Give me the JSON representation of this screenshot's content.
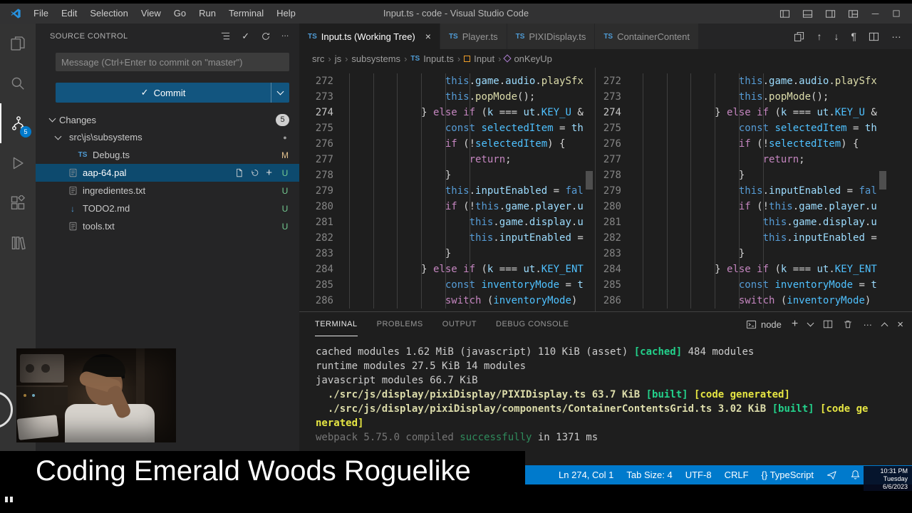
{
  "overlay": {
    "caption": "Coding Emerald Woods Roguelike",
    "clock": {
      "time": "10:31 PM",
      "day": "Tuesday",
      "date": "6/6/2023"
    }
  },
  "title_bar": {
    "menus": [
      "File",
      "Edit",
      "Selection",
      "View",
      "Go",
      "Run",
      "Terminal",
      "Help"
    ],
    "window_title": "Input.ts - code - Visual Studio Code"
  },
  "activity_bar": {
    "items": [
      {
        "name": "explorer"
      },
      {
        "name": "search"
      },
      {
        "name": "source-control",
        "active": true,
        "badge": "5"
      },
      {
        "name": "run-debug"
      },
      {
        "name": "extensions"
      },
      {
        "name": "references"
      }
    ]
  },
  "source_control": {
    "title": "SOURCE CONTROL",
    "message_placeholder": "Message (Ctrl+Enter to commit on \"master\")",
    "commit_label": "Commit",
    "changes_label": "Changes",
    "changes_badge": "5",
    "rows": [
      {
        "kind": "folder",
        "name": "src\\js\\subsystems",
        "status": "dot",
        "indent": 1,
        "twistie": true
      },
      {
        "kind": "file",
        "icon": "ts",
        "name": "Debug.ts",
        "status": "M",
        "indent": 2
      },
      {
        "kind": "file",
        "icon": "lines",
        "name": "aap-64.pal",
        "status": "U",
        "indent": 1,
        "selected": true,
        "actions": true
      },
      {
        "kind": "file",
        "icon": "lines",
        "name": "ingredientes.txt",
        "status": "U",
        "indent": 1
      },
      {
        "kind": "file",
        "icon": "md",
        "name": "TODO2.md",
        "status": "U",
        "indent": 1
      },
      {
        "kind": "file",
        "icon": "lines",
        "name": "tools.txt",
        "status": "U",
        "indent": 1
      }
    ]
  },
  "editor": {
    "tabs": [
      {
        "label": "Input.ts (Working Tree)",
        "icon": "ts",
        "active": true,
        "close": true
      },
      {
        "label": "Player.ts",
        "icon": "ts"
      },
      {
        "label": "PIXIDisplay.ts",
        "icon": "ts"
      },
      {
        "label": "ContainerContent",
        "icon": "ts"
      }
    ],
    "breadcrumbs": [
      {
        "label": "src"
      },
      {
        "label": "js"
      },
      {
        "label": "subsystems"
      },
      {
        "label": "Input.ts",
        "icon": "ts"
      },
      {
        "label": "Input",
        "icon": "class"
      },
      {
        "label": "onKeyUp",
        "icon": "method"
      }
    ],
    "active_line": 274,
    "lines": [
      {
        "n": 272,
        "t": [
          [
            "                ",
            "ws"
          ],
          [
            "this",
            "kb"
          ],
          [
            ".",
            "pu"
          ],
          [
            "game",
            "pr"
          ],
          [
            ".",
            "pu"
          ],
          [
            "audio",
            "pr"
          ],
          [
            ".",
            "pu"
          ],
          [
            "playSfx",
            "fn"
          ]
        ]
      },
      {
        "n": 273,
        "t": [
          [
            "                ",
            "ws"
          ],
          [
            "this",
            "kb"
          ],
          [
            ".",
            "pu"
          ],
          [
            "popMode",
            "fn"
          ],
          [
            "();",
            "pu"
          ]
        ]
      },
      {
        "n": 274,
        "t": [
          [
            "            ",
            "ws"
          ],
          [
            "} ",
            "pu"
          ],
          [
            "else",
            "kw"
          ],
          [
            " ",
            "ws"
          ],
          [
            "if",
            "kw"
          ],
          [
            " (",
            "pu"
          ],
          [
            "k",
            "pr"
          ],
          [
            " ",
            "ws"
          ],
          [
            "===",
            "pu"
          ],
          [
            " ",
            "ws"
          ],
          [
            "ut",
            "pr"
          ],
          [
            ".",
            "pu"
          ],
          [
            "KEY_U",
            "cn"
          ],
          [
            " &",
            "pu"
          ]
        ]
      },
      {
        "n": 275,
        "t": [
          [
            "                ",
            "ws"
          ],
          [
            "const",
            "kb"
          ],
          [
            " ",
            "ws"
          ],
          [
            "selectedItem",
            "cn"
          ],
          [
            " = ",
            "pu"
          ],
          [
            "th",
            "pr"
          ]
        ]
      },
      {
        "n": 276,
        "t": [
          [
            "                ",
            "ws"
          ],
          [
            "if",
            "kw"
          ],
          [
            " (!",
            "pu"
          ],
          [
            "selectedItem",
            "cn"
          ],
          [
            ") {",
            "pu"
          ]
        ]
      },
      {
        "n": 277,
        "t": [
          [
            "                    ",
            "ws"
          ],
          [
            "return",
            "kw"
          ],
          [
            ";",
            "pu"
          ]
        ]
      },
      {
        "n": 278,
        "t": [
          [
            "                ",
            "ws"
          ],
          [
            "}",
            "pu"
          ]
        ]
      },
      {
        "n": 279,
        "t": [
          [
            "                ",
            "ws"
          ],
          [
            "this",
            "kb"
          ],
          [
            ".",
            "pu"
          ],
          [
            "inputEnabled",
            "pr"
          ],
          [
            " = ",
            "pu"
          ],
          [
            "fal",
            "kb"
          ]
        ]
      },
      {
        "n": 280,
        "t": [
          [
            "                ",
            "ws"
          ],
          [
            "if",
            "kw"
          ],
          [
            " (!",
            "pu"
          ],
          [
            "this",
            "kb"
          ],
          [
            ".",
            "pu"
          ],
          [
            "game",
            "pr"
          ],
          [
            ".",
            "pu"
          ],
          [
            "player",
            "pr"
          ],
          [
            ".",
            "pu"
          ],
          [
            "u",
            "pr"
          ]
        ]
      },
      {
        "n": 281,
        "t": [
          [
            "                    ",
            "ws"
          ],
          [
            "this",
            "kb"
          ],
          [
            ".",
            "pu"
          ],
          [
            "game",
            "pr"
          ],
          [
            ".",
            "pu"
          ],
          [
            "display",
            "pr"
          ],
          [
            ".",
            "pu"
          ],
          [
            "u",
            "pr"
          ]
        ]
      },
      {
        "n": 282,
        "t": [
          [
            "                    ",
            "ws"
          ],
          [
            "this",
            "kb"
          ],
          [
            ".",
            "pu"
          ],
          [
            "inputEnabled",
            "pr"
          ],
          [
            " =",
            "pu"
          ]
        ]
      },
      {
        "n": 283,
        "t": [
          [
            "                ",
            "ws"
          ],
          [
            "}",
            "pu"
          ]
        ]
      },
      {
        "n": 284,
        "t": [
          [
            "            ",
            "ws"
          ],
          [
            "} ",
            "pu"
          ],
          [
            "else",
            "kw"
          ],
          [
            " ",
            "ws"
          ],
          [
            "if",
            "kw"
          ],
          [
            " (",
            "pu"
          ],
          [
            "k",
            "pr"
          ],
          [
            " ",
            "ws"
          ],
          [
            "===",
            "pu"
          ],
          [
            " ",
            "ws"
          ],
          [
            "ut",
            "pr"
          ],
          [
            ".",
            "pu"
          ],
          [
            "KEY_ENT",
            "cn"
          ]
        ]
      },
      {
        "n": 285,
        "t": [
          [
            "                ",
            "ws"
          ],
          [
            "const",
            "kb"
          ],
          [
            " ",
            "ws"
          ],
          [
            "inventoryMode",
            "cn"
          ],
          [
            " = ",
            "pu"
          ],
          [
            "t",
            "pr"
          ]
        ]
      },
      {
        "n": 286,
        "t": [
          [
            "                ",
            "ws"
          ],
          [
            "switch",
            "kw"
          ],
          [
            " (",
            "pu"
          ],
          [
            "inventoryMode",
            "cn"
          ],
          [
            ")",
            "pu"
          ]
        ]
      }
    ]
  },
  "terminal": {
    "tabs": [
      {
        "label": "TERMINAL",
        "active": true
      },
      {
        "label": "PROBLEMS"
      },
      {
        "label": "OUTPUT"
      },
      {
        "label": "DEBUG CONSOLE"
      }
    ],
    "shell_label": "node",
    "output": [
      [
        [
          "cached modules 1.62 MiB (javascript) 110 KiB (asset) ",
          "w"
        ],
        [
          "[cached]",
          "g"
        ],
        [
          " 484 modules",
          "w"
        ]
      ],
      [
        [
          "runtime modules 27.5 KiB 14 modules",
          "w"
        ]
      ],
      [
        [
          "javascript modules 66.7 KiB",
          "w"
        ]
      ],
      [
        [
          "  ./src/js/display/pixiDisplay/PIXIDisplay.ts 63.7 KiB ",
          "p"
        ],
        [
          "[built]",
          "g"
        ],
        [
          " ",
          "w"
        ],
        [
          "[code generated]",
          "y"
        ]
      ],
      [
        [
          "  ./src/js/display/pixiDisplay/components/ContainerContentsGrid.ts 3.02 KiB ",
          "p"
        ],
        [
          "[built]",
          "g"
        ],
        [
          " ",
          "w"
        ],
        [
          "[code ge",
          "y"
        ]
      ],
      [
        [
          "nerated]",
          "y"
        ]
      ],
      [
        [
          "webpack 5.75.0 compiled ",
          "dim"
        ],
        [
          "successfully",
          "dimg"
        ],
        [
          " in 1371 ms",
          "w"
        ]
      ]
    ]
  },
  "status_bar": {
    "items": [
      "Ln 274, Col 1",
      "Tab Size: 4",
      "UTF-8",
      "CRLF",
      "{} TypeScript"
    ]
  },
  "colors": {
    "accent": "#007acc",
    "untracked": "#73c991",
    "modified": "#e2c08d",
    "ts_icon": "#4f9cd6",
    "selection": "#0d4a6e"
  }
}
